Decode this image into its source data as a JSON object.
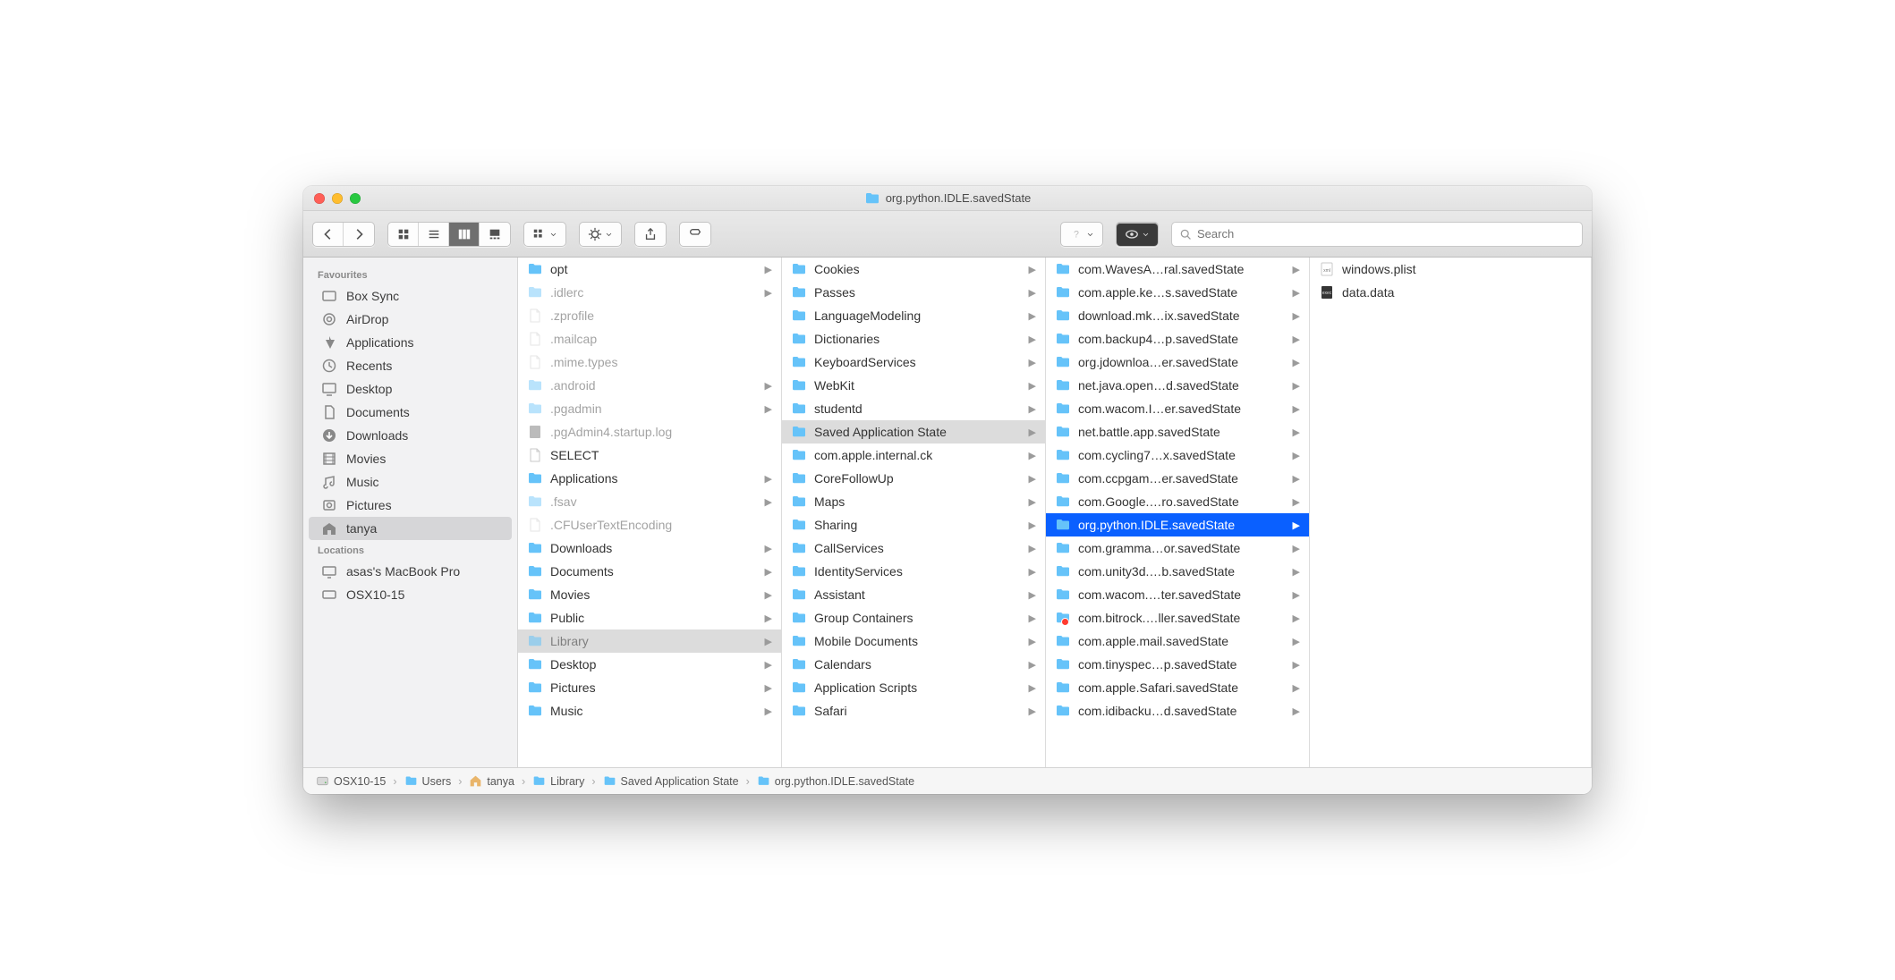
{
  "window": {
    "title": "org.python.IDLE.savedState"
  },
  "search": {
    "placeholder": "Search"
  },
  "sidebar": {
    "groups": [
      {
        "label": "Favourites",
        "items": [
          {
            "label": "Box Sync",
            "icon": "folder-outline"
          },
          {
            "label": "AirDrop",
            "icon": "airdrop"
          },
          {
            "label": "Applications",
            "icon": "apps"
          },
          {
            "label": "Recents",
            "icon": "clock"
          },
          {
            "label": "Desktop",
            "icon": "desktop"
          },
          {
            "label": "Documents",
            "icon": "doc"
          },
          {
            "label": "Downloads",
            "icon": "downloads"
          },
          {
            "label": "Movies",
            "icon": "movies"
          },
          {
            "label": "Music",
            "icon": "music"
          },
          {
            "label": "Pictures",
            "icon": "pictures"
          },
          {
            "label": "tanya",
            "icon": "home",
            "selected": true
          }
        ]
      },
      {
        "label": "Locations",
        "items": [
          {
            "label": "asas's MacBook Pro",
            "icon": "computer"
          },
          {
            "label": "OSX10-15",
            "icon": "disk"
          }
        ]
      }
    ]
  },
  "columns": [
    {
      "width": "c1",
      "items": [
        {
          "label": "opt",
          "type": "folder",
          "arrow": true
        },
        {
          "label": ".idlerc",
          "type": "folder",
          "dim": true,
          "arrow": true
        },
        {
          "label": ".zprofile",
          "type": "file",
          "dim": true
        },
        {
          "label": ".mailcap",
          "type": "file",
          "dim": true
        },
        {
          "label": ".mime.types",
          "type": "file",
          "dim": true
        },
        {
          "label": ".android",
          "type": "folder",
          "dim": true,
          "arrow": true
        },
        {
          "label": ".pgadmin",
          "type": "folder",
          "dim": true,
          "arrow": true
        },
        {
          "label": ".pgAdmin4.startup.log",
          "type": "log",
          "dim": true
        },
        {
          "label": "SELECT",
          "type": "file"
        },
        {
          "label": "Applications",
          "type": "folder",
          "arrow": true
        },
        {
          "label": ".fsav",
          "type": "folder",
          "dim": true,
          "arrow": true
        },
        {
          "label": ".CFUserTextEncoding",
          "type": "file",
          "dim": true
        },
        {
          "label": "Downloads",
          "type": "sysfolder",
          "arrow": true
        },
        {
          "label": "Documents",
          "type": "sysfolder",
          "arrow": true
        },
        {
          "label": "Movies",
          "type": "sysfolder",
          "arrow": true
        },
        {
          "label": "Public",
          "type": "sysfolder",
          "arrow": true
        },
        {
          "label": "Library",
          "type": "folder",
          "dim": true,
          "arrow": true,
          "path": true
        },
        {
          "label": "Desktop",
          "type": "sysfolder",
          "arrow": true
        },
        {
          "label": "Pictures",
          "type": "sysfolder",
          "arrow": true
        },
        {
          "label": "Music",
          "type": "sysfolder",
          "arrow": true
        }
      ]
    },
    {
      "width": "c2",
      "items": [
        {
          "label": "Cookies",
          "type": "folder",
          "arrow": true
        },
        {
          "label": "Passes",
          "type": "folder",
          "arrow": true
        },
        {
          "label": "LanguageModeling",
          "type": "folder",
          "arrow": true
        },
        {
          "label": "Dictionaries",
          "type": "folder",
          "arrow": true
        },
        {
          "label": "KeyboardServices",
          "type": "folder",
          "arrow": true
        },
        {
          "label": "WebKit",
          "type": "folder",
          "arrow": true
        },
        {
          "label": "studentd",
          "type": "folder",
          "arrow": true
        },
        {
          "label": "Saved Application State",
          "type": "folder",
          "arrow": true,
          "path": true
        },
        {
          "label": "com.apple.internal.ck",
          "type": "folder",
          "arrow": true
        },
        {
          "label": "CoreFollowUp",
          "type": "folder",
          "arrow": true
        },
        {
          "label": "Maps",
          "type": "folder",
          "arrow": true
        },
        {
          "label": "Sharing",
          "type": "folder",
          "arrow": true
        },
        {
          "label": "CallServices",
          "type": "folder",
          "arrow": true
        },
        {
          "label": "IdentityServices",
          "type": "folder",
          "arrow": true
        },
        {
          "label": "Assistant",
          "type": "folder",
          "arrow": true
        },
        {
          "label": "Group Containers",
          "type": "folder",
          "arrow": true
        },
        {
          "label": "Mobile Documents",
          "type": "folder",
          "arrow": true
        },
        {
          "label": "Calendars",
          "type": "folder",
          "arrow": true
        },
        {
          "label": "Application Scripts",
          "type": "folder",
          "arrow": true
        },
        {
          "label": "Safari",
          "type": "folder",
          "arrow": true
        }
      ]
    },
    {
      "width": "c3",
      "items": [
        {
          "label": "com.WavesA…ral.savedState",
          "type": "folder",
          "arrow": true
        },
        {
          "label": "com.apple.ke…s.savedState",
          "type": "folder",
          "arrow": true
        },
        {
          "label": "download.mk…ix.savedState",
          "type": "folder",
          "arrow": true
        },
        {
          "label": "com.backup4…p.savedState",
          "type": "folder",
          "arrow": true
        },
        {
          "label": "org.jdownloa…er.savedState",
          "type": "folder",
          "arrow": true
        },
        {
          "label": "net.java.open…d.savedState",
          "type": "folder",
          "arrow": true
        },
        {
          "label": "com.wacom.I…er.savedState",
          "type": "folder",
          "arrow": true
        },
        {
          "label": "net.battle.app.savedState",
          "type": "folder",
          "arrow": true
        },
        {
          "label": "com.cycling7…x.savedState",
          "type": "folder",
          "arrow": true
        },
        {
          "label": "com.ccpgam…er.savedState",
          "type": "folder",
          "arrow": true
        },
        {
          "label": "com.Google.…ro.savedState",
          "type": "folder",
          "arrow": true
        },
        {
          "label": "org.python.IDLE.savedState",
          "type": "folder",
          "arrow": true,
          "selected": true
        },
        {
          "label": "com.gramma…or.savedState",
          "type": "folder",
          "arrow": true
        },
        {
          "label": "com.unity3d.…b.savedState",
          "type": "folder",
          "arrow": true
        },
        {
          "label": "com.wacom.…ter.savedState",
          "type": "folder",
          "arrow": true
        },
        {
          "label": "com.bitrock.…ller.savedState",
          "type": "folder",
          "arrow": true,
          "badge": "stop"
        },
        {
          "label": "com.apple.mail.savedState",
          "type": "alias",
          "arrow": true
        },
        {
          "label": "com.tinyspec…p.savedState",
          "type": "alias",
          "arrow": true
        },
        {
          "label": "com.apple.Safari.savedState",
          "type": "alias",
          "arrow": true
        },
        {
          "label": "com.idibacku…d.savedState",
          "type": "alias",
          "arrow": true
        }
      ]
    },
    {
      "width": "c4",
      "items": [
        {
          "label": "windows.plist",
          "type": "plist"
        },
        {
          "label": "data.data",
          "type": "data"
        }
      ]
    }
  ],
  "pathbar": [
    {
      "label": "OSX10-15",
      "icon": "disk"
    },
    {
      "label": "Users",
      "icon": "folder"
    },
    {
      "label": "tanya",
      "icon": "home"
    },
    {
      "label": "Library",
      "icon": "folder"
    },
    {
      "label": "Saved Application State",
      "icon": "folder"
    },
    {
      "label": "org.python.IDLE.savedState",
      "icon": "folder"
    }
  ]
}
